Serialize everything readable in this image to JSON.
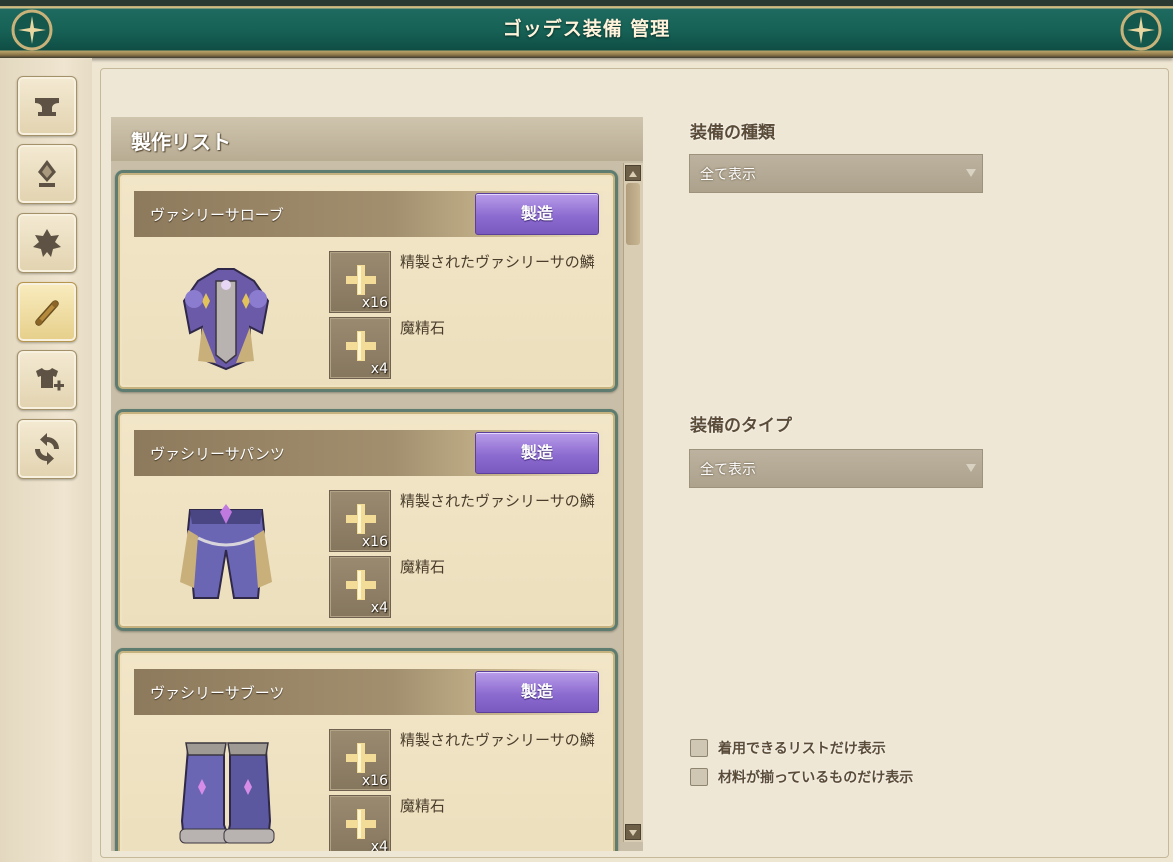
{
  "window": {
    "title": "ゴッデス装備 管理"
  },
  "sidebar": {
    "tools": [
      {
        "icon": "anvil-icon"
      },
      {
        "icon": "crystal-icon"
      },
      {
        "icon": "leaf-icon"
      },
      {
        "icon": "scroll-icon",
        "active": true
      },
      {
        "icon": "armor-add-icon"
      },
      {
        "icon": "refresh-icon"
      }
    ]
  },
  "craft_list": {
    "title": "製作リスト",
    "items": [
      {
        "name": "ヴァシリーサローブ",
        "button": "製造",
        "materials": [
          {
            "name": "精製されたヴァシリーサの鱗",
            "qty": "x16"
          },
          {
            "name": "魔精石",
            "qty": "x4"
          }
        ]
      },
      {
        "name": "ヴァシリーサパンツ",
        "button": "製造",
        "materials": [
          {
            "name": "精製されたヴァシリーサの鱗",
            "qty": "x16"
          },
          {
            "name": "魔精石",
            "qty": "x4"
          }
        ]
      },
      {
        "name": "ヴァシリーサブーツ",
        "button": "製造",
        "materials": [
          {
            "name": "精製されたヴァシリーサの鱗",
            "qty": "x16"
          },
          {
            "name": "魔精石",
            "qty": "x4"
          }
        ]
      }
    ]
  },
  "filters": {
    "equipment_kind": {
      "label": "装備の種類",
      "value": "全て表示"
    },
    "equipment_type": {
      "label": "装備のタイプ",
      "value": "全て表示"
    },
    "checkboxes": [
      {
        "label": "着用できるリストだけ表示",
        "checked": false
      },
      {
        "label": "材料が揃っているものだけ表示",
        "checked": false
      }
    ]
  },
  "colors": {
    "title_bar": "#176256",
    "craft_button": "#8d6cd0",
    "card_frame": "#5e7d70"
  }
}
